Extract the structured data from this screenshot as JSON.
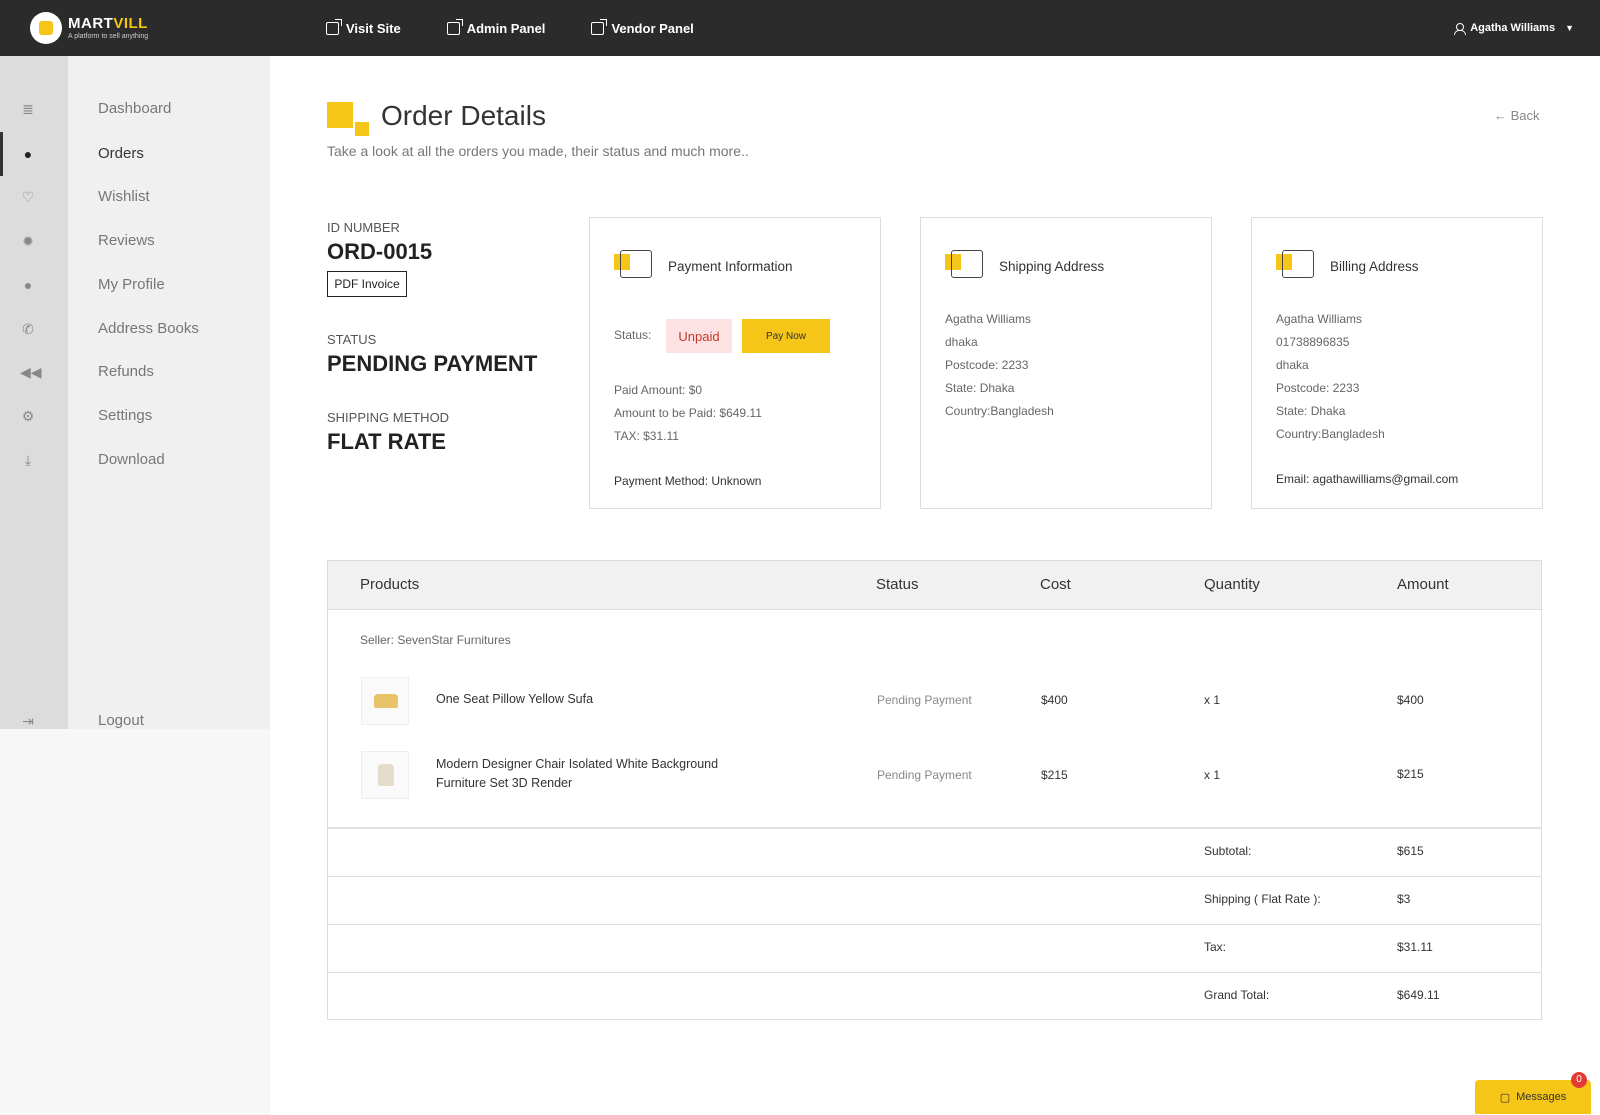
{
  "brand": {
    "name_white": "MART",
    "name_yellow": "VILL",
    "tagline": "A platform to sell anything"
  },
  "topnav": [
    {
      "label": "Visit Site"
    },
    {
      "label": "Admin Panel"
    },
    {
      "label": "Vendor Panel"
    }
  ],
  "user": {
    "name": "Agatha Williams"
  },
  "sidebar": {
    "items": [
      {
        "label": "Dashboard",
        "icon": "list-icon"
      },
      {
        "label": "Orders",
        "icon": "apple-icon"
      },
      {
        "label": "Wishlist",
        "icon": "heart-icon"
      },
      {
        "label": "Reviews",
        "icon": "star-badge-icon"
      },
      {
        "label": "My Profile",
        "icon": "user-icon"
      },
      {
        "label": "Address Books",
        "icon": "phone-icon"
      },
      {
        "label": "Refunds",
        "icon": "rewind-icon"
      },
      {
        "label": "Settings",
        "icon": "gear-icon"
      },
      {
        "label": "Download",
        "icon": "download-icon"
      }
    ],
    "logout": "Logout"
  },
  "header": {
    "title": "Order Details",
    "subtitle": "Take a look at all the orders you made, their status and much more..",
    "back": "Back"
  },
  "order": {
    "id_label": "ID NUMBER",
    "id": "ORD-0015",
    "pdf_button": "PDF Invoice",
    "status_label": "STATUS",
    "status": "PENDING PAYMENT",
    "shipping_method_label": "SHIPPING METHOD",
    "shipping_method": "FLAT RATE"
  },
  "payment": {
    "title": "Payment Information",
    "status_label": "Status:",
    "status": "Unpaid",
    "pay_button": "Pay Now",
    "paid_amount": "Paid Amount: $0",
    "to_be_paid": "Amount to be Paid: $649.11",
    "tax": "TAX: $31.11",
    "method": "Payment Method: Unknown"
  },
  "shipping": {
    "title": "Shipping Address",
    "lines": [
      "Agatha Williams",
      "dhaka",
      "Postcode: 2233",
      "State: Dhaka",
      "Country:Bangladesh"
    ]
  },
  "billing": {
    "title": "Billing Address",
    "lines": [
      "Agatha Williams",
      "01738896835",
      "dhaka",
      "Postcode: 2233",
      "State: Dhaka",
      "Country:Bangladesh"
    ],
    "email": "Email: agathawilliams@gmail.com"
  },
  "table": {
    "headers": [
      "Products",
      "Status",
      "Cost",
      "Quantity",
      "Amount"
    ],
    "seller": "Seller: SevenStar Furnitures",
    "rows": [
      {
        "name": "One Seat Pillow Yellow Sufa",
        "status": "Pending Payment",
        "cost": "$400",
        "qty": "x 1",
        "amount": "$400"
      },
      {
        "name": "Modern Designer Chair Isolated White Background Furniture Set 3D Render",
        "status": "Pending Payment",
        "cost": "$215",
        "qty": "x 1",
        "amount": "$215"
      }
    ],
    "summary": [
      {
        "label": "Subtotal:",
        "value": "$615"
      },
      {
        "label": "Shipping ( Flat Rate ):",
        "value": "$3"
      },
      {
        "label": "Tax:",
        "value": "$31.11"
      },
      {
        "label": "Grand Total:",
        "value": "$649.11"
      }
    ]
  },
  "messages": {
    "label": "Messages",
    "count": "0"
  },
  "colors": {
    "accent": "#f5c518",
    "topbar": "#2b2b2b",
    "unpaid_bg": "#fde2e4",
    "unpaid_text": "#c0392b"
  }
}
